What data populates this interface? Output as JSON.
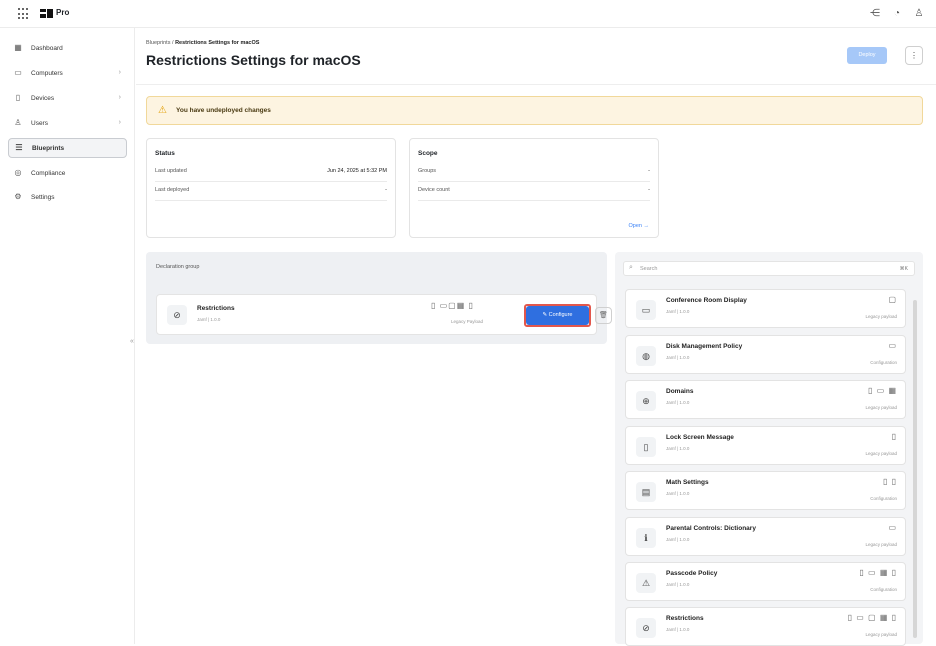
{
  "topbar": {
    "brand": "Pro",
    "icons": [
      "grid-icon",
      "share-icon",
      "bell-icon",
      "user-icon"
    ]
  },
  "sidebar": {
    "items": [
      {
        "label": "Dashboard",
        "icon": "dashboard-icon"
      },
      {
        "label": "Computers",
        "icon": "laptop-icon",
        "chevron": "›"
      },
      {
        "label": "Devices",
        "icon": "devices-icon",
        "chevron": "›"
      },
      {
        "label": "Users",
        "icon": "users-icon",
        "chevron": "›"
      },
      {
        "label": "Blueprints",
        "icon": "blueprints-icon",
        "active": true
      },
      {
        "label": "Compliance",
        "icon": "shield-icon"
      },
      {
        "label": "Settings",
        "icon": "gear-icon"
      }
    ]
  },
  "header": {
    "breadcrumb_parent": "Blueprints",
    "breadcrumb_current": "Restrictions Settings for macOS",
    "title": "Restrictions Settings for macOS",
    "deploy_label": "Deploy",
    "more_label": "⋮"
  },
  "banner": {
    "text": "You have undeployed changes",
    "color": "#fdf4e1"
  },
  "status": {
    "heading": "Status",
    "rows": [
      {
        "label": "Last updated",
        "value": "Jun 24, 2025 at 5:32 PM"
      },
      {
        "label": "Last deployed",
        "value": "-"
      }
    ]
  },
  "scope": {
    "heading": "Scope",
    "rows": [
      {
        "label": "Groups",
        "value": "-"
      },
      {
        "label": "Device count",
        "value": "-"
      }
    ],
    "open_label": "Open →"
  },
  "declaration_group": {
    "label": "Declaration group",
    "item": {
      "name": "Restrictions",
      "sub": "Jamf | 1.0.0",
      "devices": "▯ ▭▢▦ ▯",
      "payload_type": "Legacy Payload",
      "configure_label": "Configure"
    }
  },
  "library": {
    "search_placeholder": "Search",
    "search_shortcut": "⌘K",
    "items": [
      {
        "name": "Conference Room Display",
        "sub": "Jamf | 1.0.0",
        "icon": "monitor-icon",
        "glyph": "▭",
        "devices": "▢",
        "type": "Legacy payload"
      },
      {
        "name": "Disk Management Policy",
        "sub": "Jamf | 1.0.0",
        "icon": "disk-icon",
        "glyph": "◍",
        "devices": "▭",
        "type": "Configuration"
      },
      {
        "name": "Domains",
        "sub": "Jamf | 1.0.0",
        "icon": "globe-icon",
        "glyph": "⊕",
        "devices": "▯ ▭ ▦",
        "type": "Legacy payload"
      },
      {
        "name": "Lock Screen Message",
        "sub": "Jamf | 1.0.0",
        "icon": "phone-lock-icon",
        "glyph": "▯",
        "devices": "▯",
        "type": "Legacy payload"
      },
      {
        "name": "Math Settings",
        "sub": "Jamf | 1.0.0",
        "icon": "calculator-icon",
        "glyph": "▤",
        "devices": "▯ ▯",
        "type": "Configuration"
      },
      {
        "name": "Parental Controls: Dictionary",
        "sub": "Jamf | 1.0.0",
        "icon": "dictionary-icon",
        "glyph": "ℹ",
        "devices": "▭",
        "type": "Legacy payload"
      },
      {
        "name": "Passcode Policy",
        "sub": "Jamf | 1.0.0",
        "icon": "passcode-icon",
        "glyph": "⚠",
        "devices": "▯ ▭ ▦ ▯",
        "type": "Configuration"
      },
      {
        "name": "Restrictions",
        "sub": "Jamf | 1.0.0",
        "icon": "restrict-icon",
        "glyph": "⊘",
        "devices": "▯ ▭ ▢ ▦ ▯",
        "type": "Legacy payload"
      }
    ]
  },
  "colors": {
    "accent": "#2f6fe0",
    "highlight": "#e2574c"
  }
}
